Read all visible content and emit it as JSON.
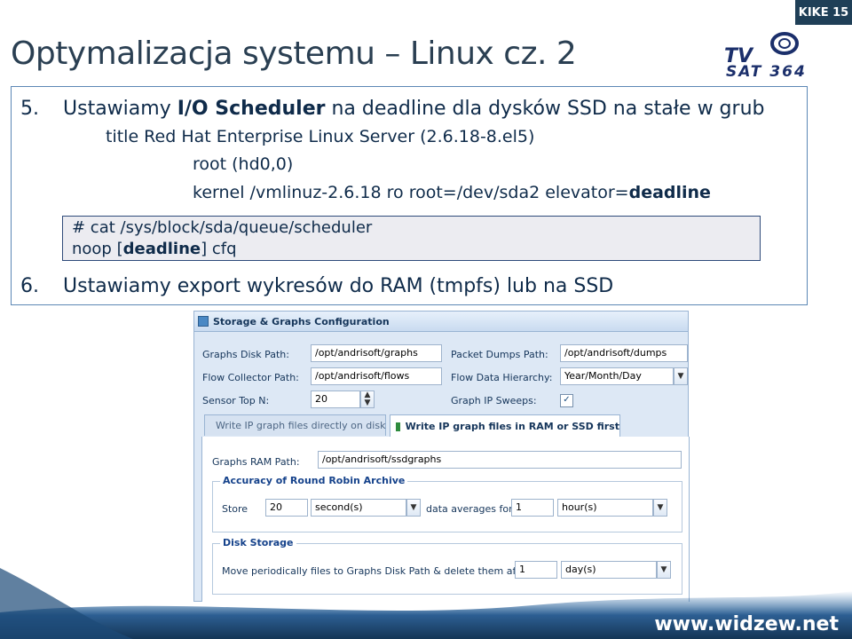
{
  "slide": {
    "tag": "KIKE 15",
    "title": "Optymalizacja systemu – Linux cz. 2",
    "logo_text": "TV SAT 364",
    "footer": "www.widzew.net"
  },
  "steps": {
    "s5_num": "5.",
    "s5_a": "Ustawiamy ",
    "s5_b": "I/O Scheduler",
    "s5_c": " na deadline dla dysków SSD na stałe w grub",
    "s5_title_line": "title Red Hat Enterprise Linux Server (2.6.18-8.el5)",
    "s5_root_line": "root (hd0,0)",
    "s5_kernel_a": "kernel /vmlinuz-2.6.18 ro root=/dev/sda2 elevator=",
    "s5_kernel_b": "deadline",
    "code_line1": "# cat /sys/block/sda/queue/scheduler",
    "code_line2_a": "noop [",
    "code_line2_b": "deadline",
    "code_line2_c": "] cfq",
    "s6_num": "6.",
    "s6_text": "Ustawiamy export wykresów do RAM (tmpfs) lub na SSD"
  },
  "config": {
    "header": "Storage & Graphs Configuration",
    "graphs_disk_label": "Graphs Disk Path:",
    "graphs_disk_value": "/opt/andrisoft/graphs",
    "packet_dumps_label": "Packet Dumps Path:",
    "packet_dumps_value": "/opt/andrisoft/dumps",
    "flow_collector_label": "Flow Collector Path:",
    "flow_collector_value": "/opt/andrisoft/flows",
    "flow_hierarchy_label": "Flow Data Hierarchy:",
    "flow_hierarchy_value": "Year/Month/Day",
    "sensor_top_label": "Sensor Top N:",
    "sensor_top_value": "20",
    "graph_sweeps_label": "Graph IP Sweeps:",
    "graph_sweeps_checked": true,
    "tab1": "Write IP graph files directly on disk",
    "tab2": "Write IP graph files in RAM or SSD first",
    "ram_path_label": "Graphs RAM Path:",
    "ram_path_value": "/opt/andrisoft/ssdgraphs",
    "rra_legend": "Accuracy of Round Robin Archive",
    "store_label": "Store",
    "store_value": "20",
    "store_unit": "second(s)",
    "averages_label": "data averages for",
    "averages_value": "1",
    "averages_unit": "hour(s)",
    "disk_legend": "Disk Storage",
    "move_label": "Move periodically files to Graphs Disk Path & delete them after",
    "move_value": "1",
    "move_unit": "day(s)"
  }
}
